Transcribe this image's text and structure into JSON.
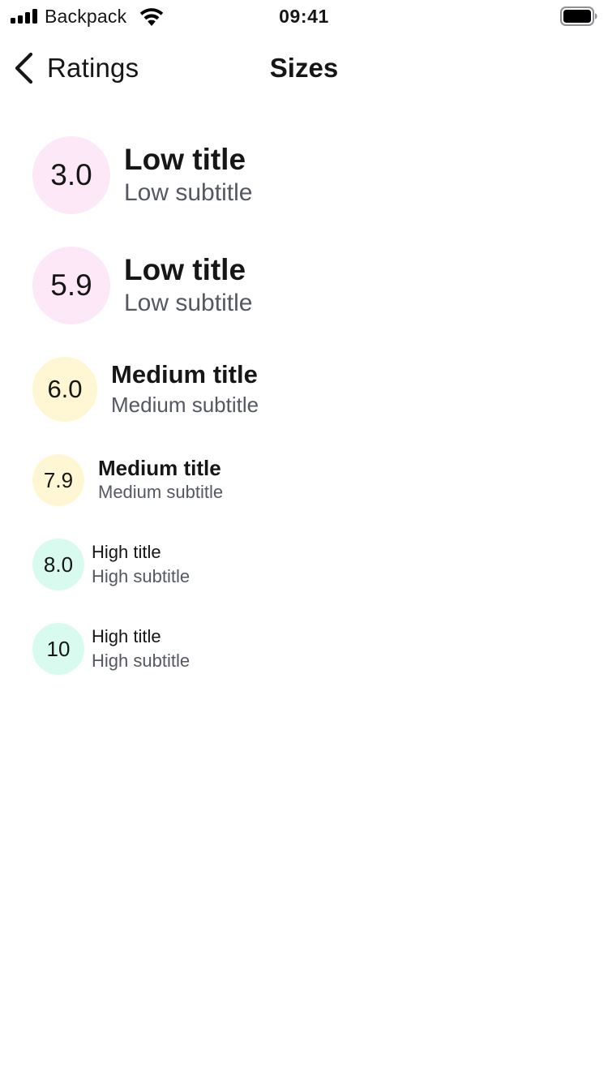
{
  "status_bar": {
    "carrier": "Backpack",
    "time": "09:41",
    "signal_icon": "cellular-signal-icon",
    "wifi_icon": "wifi-icon",
    "battery_icon": "battery-icon"
  },
  "nav": {
    "back_label": "Ratings",
    "back_icon": "chevron-left-icon",
    "title": "Sizes"
  },
  "colors": {
    "low": "#fce8f6",
    "medium": "#fff7d4",
    "high": "#d9fbef",
    "subtitle": "#545860",
    "text": "#161616"
  },
  "ratings": [
    {
      "value": "3.0",
      "title": "Low title",
      "subtitle": "Low subtitle",
      "level": "low",
      "size": "large"
    },
    {
      "value": "5.9",
      "title": "Low title",
      "subtitle": "Low subtitle",
      "level": "low",
      "size": "large"
    },
    {
      "value": "6.0",
      "title": "Medium title",
      "subtitle": "Medium subtitle",
      "level": "medium",
      "size": "base"
    },
    {
      "value": "7.9",
      "title": "Medium title",
      "subtitle": "Medium subtitle",
      "level": "medium",
      "size": "small"
    },
    {
      "value": "8.0",
      "title": "High title",
      "subtitle": "High subtitle",
      "level": "high",
      "size": "extra-small"
    },
    {
      "value": "10",
      "title": "High title",
      "subtitle": "High subtitle",
      "level": "high",
      "size": "extra-small"
    }
  ]
}
